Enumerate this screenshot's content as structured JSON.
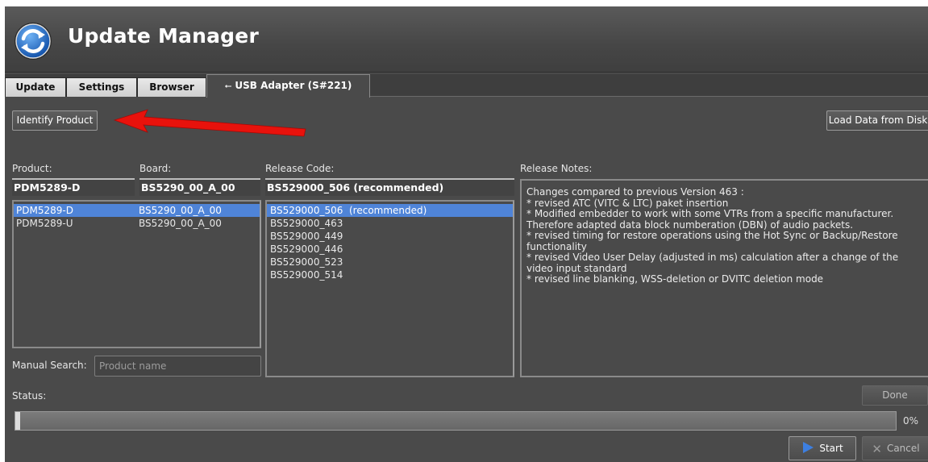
{
  "header": {
    "title": "Update Manager"
  },
  "tabs": [
    {
      "label": "Update"
    },
    {
      "label": "Settings"
    },
    {
      "label": "Browser"
    },
    {
      "label": "USB Adapter (S#221)",
      "active": true
    }
  ],
  "toolbar": {
    "identify_label": "Identify Product",
    "load_label": "Load Data from Disk"
  },
  "product": {
    "label": "Product:",
    "selected": "PDM5289-D",
    "items": [
      {
        "name": "PDM5289-D",
        "board": "BS5290_00_A_00",
        "selected": true
      },
      {
        "name": "PDM5289-U",
        "board": "BS5290_00_A_00",
        "selected": false
      }
    ]
  },
  "board": {
    "label": "Board:",
    "selected": "BS5290_00_A_00"
  },
  "release_code": {
    "label": "Release Code:",
    "selected": "BS529000_506  (recommended)",
    "items": [
      "BS529000_506  (recommended)",
      "BS529000_463",
      "BS529000_449",
      "BS529000_446",
      "BS529000_523",
      "BS529000_514"
    ]
  },
  "release_notes": {
    "label": "Release Notes:",
    "lines": [
      "Changes compared to previous Version 463 :",
      "* revised ATC (VITC & LTC) paket insertion",
      "* Modified embedder to work with some VTRs from a specific manufacturer. Therefore adapted data block numberation (DBN) of audio packets.",
      "* revised timing for restore operations using the Hot Sync or Backup/Restore functionality",
      "* revised Video User Delay (adjusted in ms) calculation after a change of the video input standard",
      "* revised line blanking, WSS-deletion or DVITC deletion mode"
    ]
  },
  "search": {
    "label": "Manual Search:",
    "placeholder": "Product name"
  },
  "status": {
    "label": "Status:",
    "done_label": "Done",
    "progress": 0,
    "progress_text": "0%"
  },
  "actions": {
    "start_label": "Start",
    "cancel_label": "Cancel"
  },
  "colors": {
    "selection": "#4f84d8",
    "annotation_arrow": "#e8120c",
    "accent_play": "#3d7fe0"
  }
}
